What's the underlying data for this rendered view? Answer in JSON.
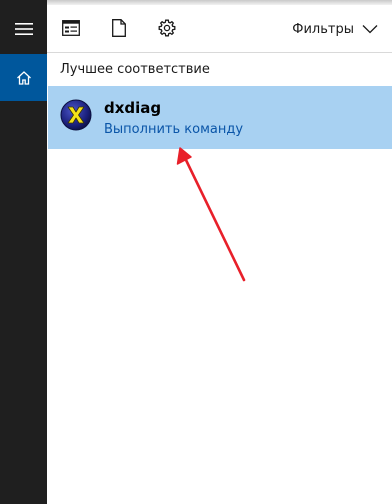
{
  "sidebar": {
    "menu_icon": "hamburger-menu-icon",
    "home_icon": "home-icon"
  },
  "toolbar": {
    "apps_icon": "apps-icon",
    "documents_icon": "document-icon",
    "settings_icon": "gear-icon",
    "filters_label": "Фильтры",
    "filters_chevron": "chevron-down-icon"
  },
  "results": {
    "section_title": "Лучшее соответствие",
    "best_match": {
      "name": "dxdiag",
      "action": "Выполнить команду",
      "icon": "dxdiag-icon"
    }
  },
  "colors": {
    "rail": "#1f1f1f",
    "home_active": "#00579c",
    "result_highlight": "#a8d1f2",
    "action_link": "#0a55a8",
    "annotation_arrow": "#e8202a"
  }
}
